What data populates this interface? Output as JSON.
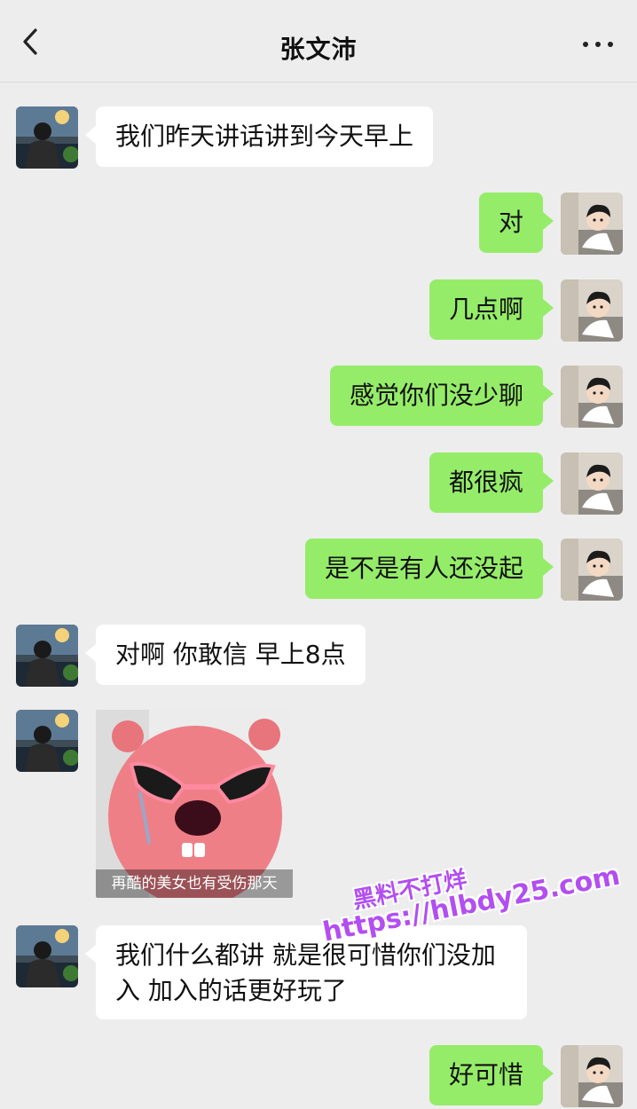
{
  "header": {
    "title": "张文沛",
    "back_icon": "chevron-left-icon",
    "more_icon": "more-dots-icon"
  },
  "colors": {
    "background": "#ededed",
    "bubble_mine": "#95ec69",
    "bubble_other": "#ffffff",
    "watermark": "#b34ef0"
  },
  "messages": [
    {
      "sender": "other",
      "text": "我们昨天讲话讲到今天早上"
    },
    {
      "sender": "me",
      "text": "对"
    },
    {
      "sender": "me",
      "text": "几点啊"
    },
    {
      "sender": "me",
      "text": "感觉你们没少聊"
    },
    {
      "sender": "me",
      "text": "都很疯"
    },
    {
      "sender": "me",
      "text": "是不是有人还没起"
    },
    {
      "sender": "other",
      "text": "对啊 你敢信 早上8点"
    },
    {
      "sender": "other",
      "type": "sticker",
      "caption": "再酷的美女也有受伤那天"
    },
    {
      "sender": "other",
      "text": "我们什么都讲 就是很可惜你们没加入 加入的话更好玩了"
    },
    {
      "sender": "me",
      "text": "好可惜"
    }
  ],
  "watermark": {
    "line1": "黑料不打烊",
    "line2": "https://hlbdy25.com"
  }
}
